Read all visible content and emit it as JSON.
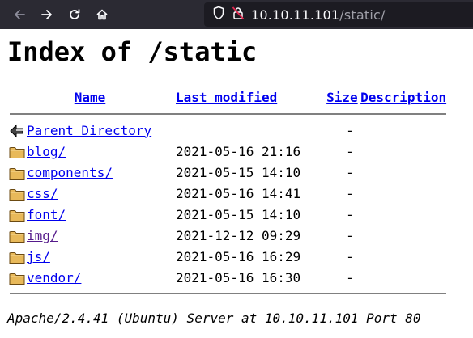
{
  "browser": {
    "url_host": "10.10.11.101",
    "url_path": "/static/",
    "icons": [
      "back-arrow-icon",
      "forward-arrow-icon",
      "reload-icon",
      "home-icon",
      "shield-icon",
      "insecure-lock-icon"
    ]
  },
  "page": {
    "title": "Index of /static",
    "columns": {
      "name": "Name",
      "last_modified": "Last modified",
      "size": "Size",
      "description": "Description"
    },
    "parent": {
      "label": "Parent Directory",
      "size": "-",
      "icon": "back-folder-icon"
    },
    "entries": [
      {
        "name": "blog/",
        "modified": "2021-05-16 21:16",
        "size": "-",
        "icon": "folder-icon",
        "visited": false
      },
      {
        "name": "components/",
        "modified": "2021-05-15 14:10",
        "size": "-",
        "icon": "folder-icon",
        "visited": false
      },
      {
        "name": "css/",
        "modified": "2021-05-16 14:41",
        "size": "-",
        "icon": "folder-icon",
        "visited": false
      },
      {
        "name": "font/",
        "modified": "2021-05-15 14:10",
        "size": "-",
        "icon": "folder-icon",
        "visited": false
      },
      {
        "name": "img/",
        "modified": "2021-12-12 09:29",
        "size": "-",
        "icon": "folder-icon",
        "visited": true
      },
      {
        "name": "js/",
        "modified": "2021-05-16 16:29",
        "size": "-",
        "icon": "folder-icon",
        "visited": false
      },
      {
        "name": "vendor/",
        "modified": "2021-05-16 16:30",
        "size": "-",
        "icon": "folder-icon",
        "visited": false
      }
    ],
    "footer": "Apache/2.4.41 (Ubuntu) Server at 10.10.11.101 Port 80"
  },
  "colors": {
    "toolbar_bg": "#2b2a33",
    "urlbar_bg": "#1c1b22",
    "link": "#0000ee",
    "visited_link": "#551a8b",
    "rule": "#808080"
  }
}
